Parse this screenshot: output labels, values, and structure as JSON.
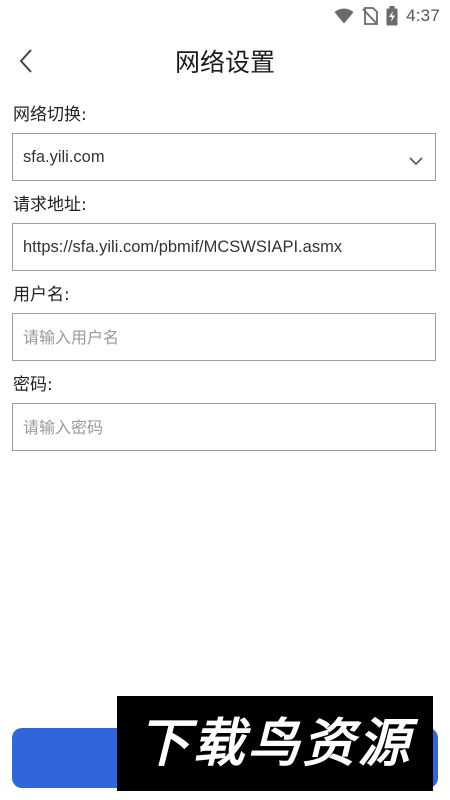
{
  "status_bar": {
    "time": "4:37"
  },
  "header": {
    "title": "网络设置",
    "back_icon": "chevron-left-icon"
  },
  "form": {
    "network_switch": {
      "label": "网络切换:",
      "selected_value": "sfa.yili.com"
    },
    "request_url": {
      "label": "请求地址:",
      "value": "https://sfa.yili.com/pbmif/MCSWSIAPI.asmx"
    },
    "username": {
      "label": "用户名:",
      "placeholder": "请输入用户名"
    },
    "password": {
      "label": "密码:",
      "placeholder": "请输入密码"
    }
  },
  "watermark": {
    "text": "下载鸟资源"
  },
  "colors": {
    "accent": "#2f66db",
    "border": "#9e9e9e",
    "placeholder": "#9a9a9a"
  }
}
